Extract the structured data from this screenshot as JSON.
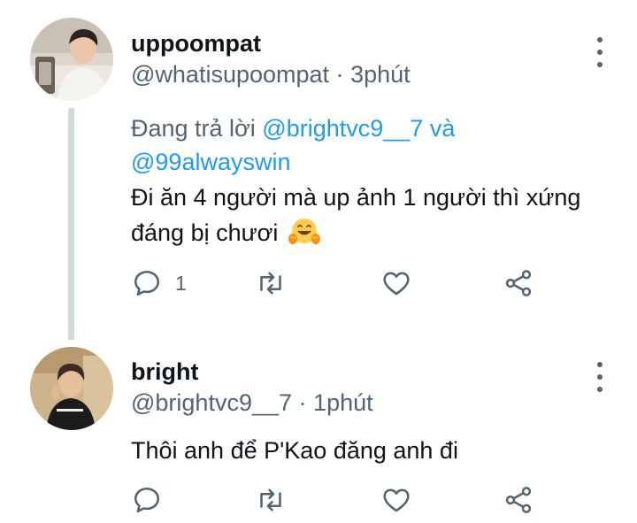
{
  "tweets": [
    {
      "name": "uppoompat",
      "handle": "@whatisupoompat",
      "separator": "·",
      "time": "3phút",
      "reply_prefix": "Đang trả lời",
      "reply_mention_1": "@brightvc9__7",
      "reply_joiner": "và",
      "reply_mention_2": "@99alwayswin",
      "text": "Đi ăn 4 người mà up ảnh 1 người thì xứng đáng bị chươi",
      "emoji": "hugging-face-emoji",
      "reply_count": "1"
    },
    {
      "name": "bright",
      "handle": "@brightvc9__7",
      "separator": "·",
      "time": "1phút",
      "text": "Thôi anh để P'Kao đăng anh đi",
      "reply_count": ""
    }
  ],
  "icons": {
    "reply": "reply-bubble-icon",
    "retweet": "retweet-icon",
    "like": "heart-icon",
    "share": "share-icon",
    "more": "more-vertical-icon"
  },
  "colors": {
    "text_primary": "#0f1419",
    "text_secondary": "#536471",
    "link": "#1d9bf0",
    "thread_line": "#cfd9de",
    "background": "#ffffff"
  }
}
